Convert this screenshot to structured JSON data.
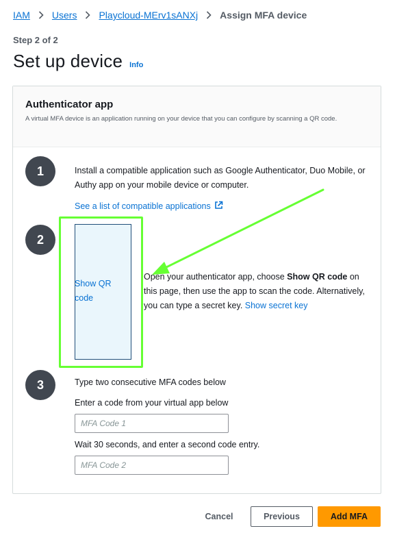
{
  "breadcrumb": {
    "items": [
      "IAM",
      "Users",
      "Playcloud-MErv1sANXj"
    ],
    "current": "Assign MFA device"
  },
  "header": {
    "step": "Step 2 of 2",
    "title": "Set up device",
    "info": "Info"
  },
  "panel": {
    "title": "Authenticator app",
    "description": "A virtual MFA device is an application running on your device that you can configure by scanning a QR code."
  },
  "steps": {
    "step1": {
      "number": "1",
      "text": "Install a compatible application such as Google Authenticator, Duo Mobile, or Authy app on your mobile device or computer.",
      "link": "See a list of compatible applications"
    },
    "step2": {
      "number": "2",
      "qr_button": "Show QR code",
      "text_pre": "Open your authenticator app, choose ",
      "text_bold": "Show QR code",
      "text_post": " on this page, then use the app to scan the code. Alternatively, you can type a secret key. ",
      "secret_link": "Show secret key"
    },
    "step3": {
      "number": "3",
      "text": "Type two consecutive MFA codes below",
      "code1_label": "Enter a code from your virtual app below",
      "code1_placeholder": "MFA Code 1",
      "code2_label": "Wait 30 seconds, and enter a second code entry.",
      "code2_placeholder": "MFA Code 2"
    }
  },
  "footer": {
    "cancel": "Cancel",
    "previous": "Previous",
    "add": "Add MFA"
  },
  "colors": {
    "link": "#0972d3",
    "primary_button": "#ff9900",
    "highlight": "#66ff33",
    "step_circle": "#414750"
  },
  "icons": {
    "breadcrumb_separator": "chevron-right-icon",
    "external_link": "external-link-icon"
  }
}
